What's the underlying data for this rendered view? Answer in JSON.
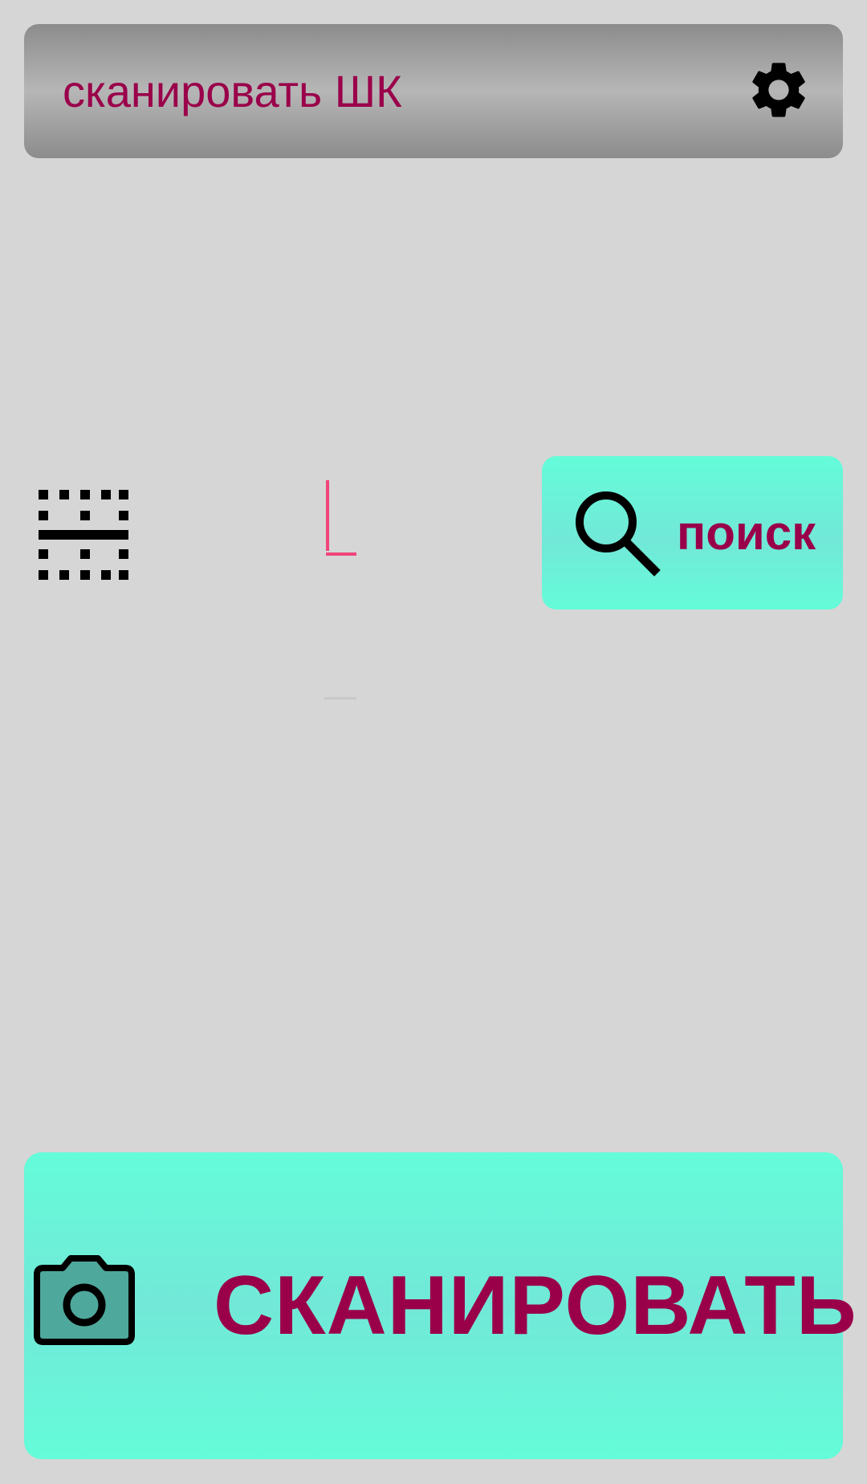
{
  "header": {
    "title": "сканировать ШК",
    "settings_icon": "gear-icon"
  },
  "scanner_mode": {
    "icon": "barcode-scan-mode-icon"
  },
  "barcode_input": {
    "value": "",
    "placeholder": ""
  },
  "search": {
    "label": "поиск",
    "icon": "search-icon"
  },
  "scan_button": {
    "label": "СКАНИРОВАТЬ",
    "icon": "camera-icon"
  },
  "colors": {
    "background": "#d6d6d6",
    "accent_text": "#9a004a",
    "button_fill": "#64fcd9",
    "cursor": "#f0457a",
    "header_fill": "#a0a0a0"
  }
}
